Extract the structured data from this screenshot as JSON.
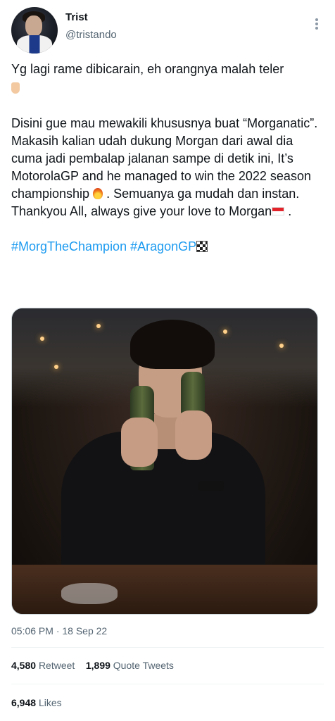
{
  "author": {
    "name": "Trist",
    "handle": "@tristando"
  },
  "tweet": {
    "line1": "Yg lagi rame dibicarain, eh orangnya malah teler",
    "line1_emoji": "pointing-down-hand-emoji",
    "para2_a": "Disini gue mau mewakili khususnya buat “Morganatic”. Makasih kalian udah dukung Morgan dari awal dia cuma jadi pembalap jalanan sampe di detik ini, It’s MotorolaGP and he managed to win the 2022 season championship",
    "para2_b": " . Semuanya ga mudah dan instan. Thankyou All, always give your love to Morgan",
    "para2_c": " .",
    "hashtag1": "#MorgTheChampion",
    "hashtag2": "#AragonGP",
    "emoji_fire": "fire-emoji",
    "emoji_flag": "indonesia-flag-emoji",
    "emoji_checkered": "checkered-flag-emoji"
  },
  "photo": {
    "alt_subject": "man in black shirt holding two bottles at a bar"
  },
  "meta": {
    "timestamp": "05:06 PM · 18 Sep 22"
  },
  "stats": {
    "retweets_count": "4,580",
    "retweets_label": "Retweet",
    "quotes_count": "1,899",
    "quotes_label": "Quote Tweets",
    "likes_count": "6,948",
    "likes_label": "Likes"
  },
  "colors": {
    "text": "#0f1419",
    "secondary": "#536471",
    "link": "#1d9bf0",
    "divider": "#eff3f4"
  }
}
